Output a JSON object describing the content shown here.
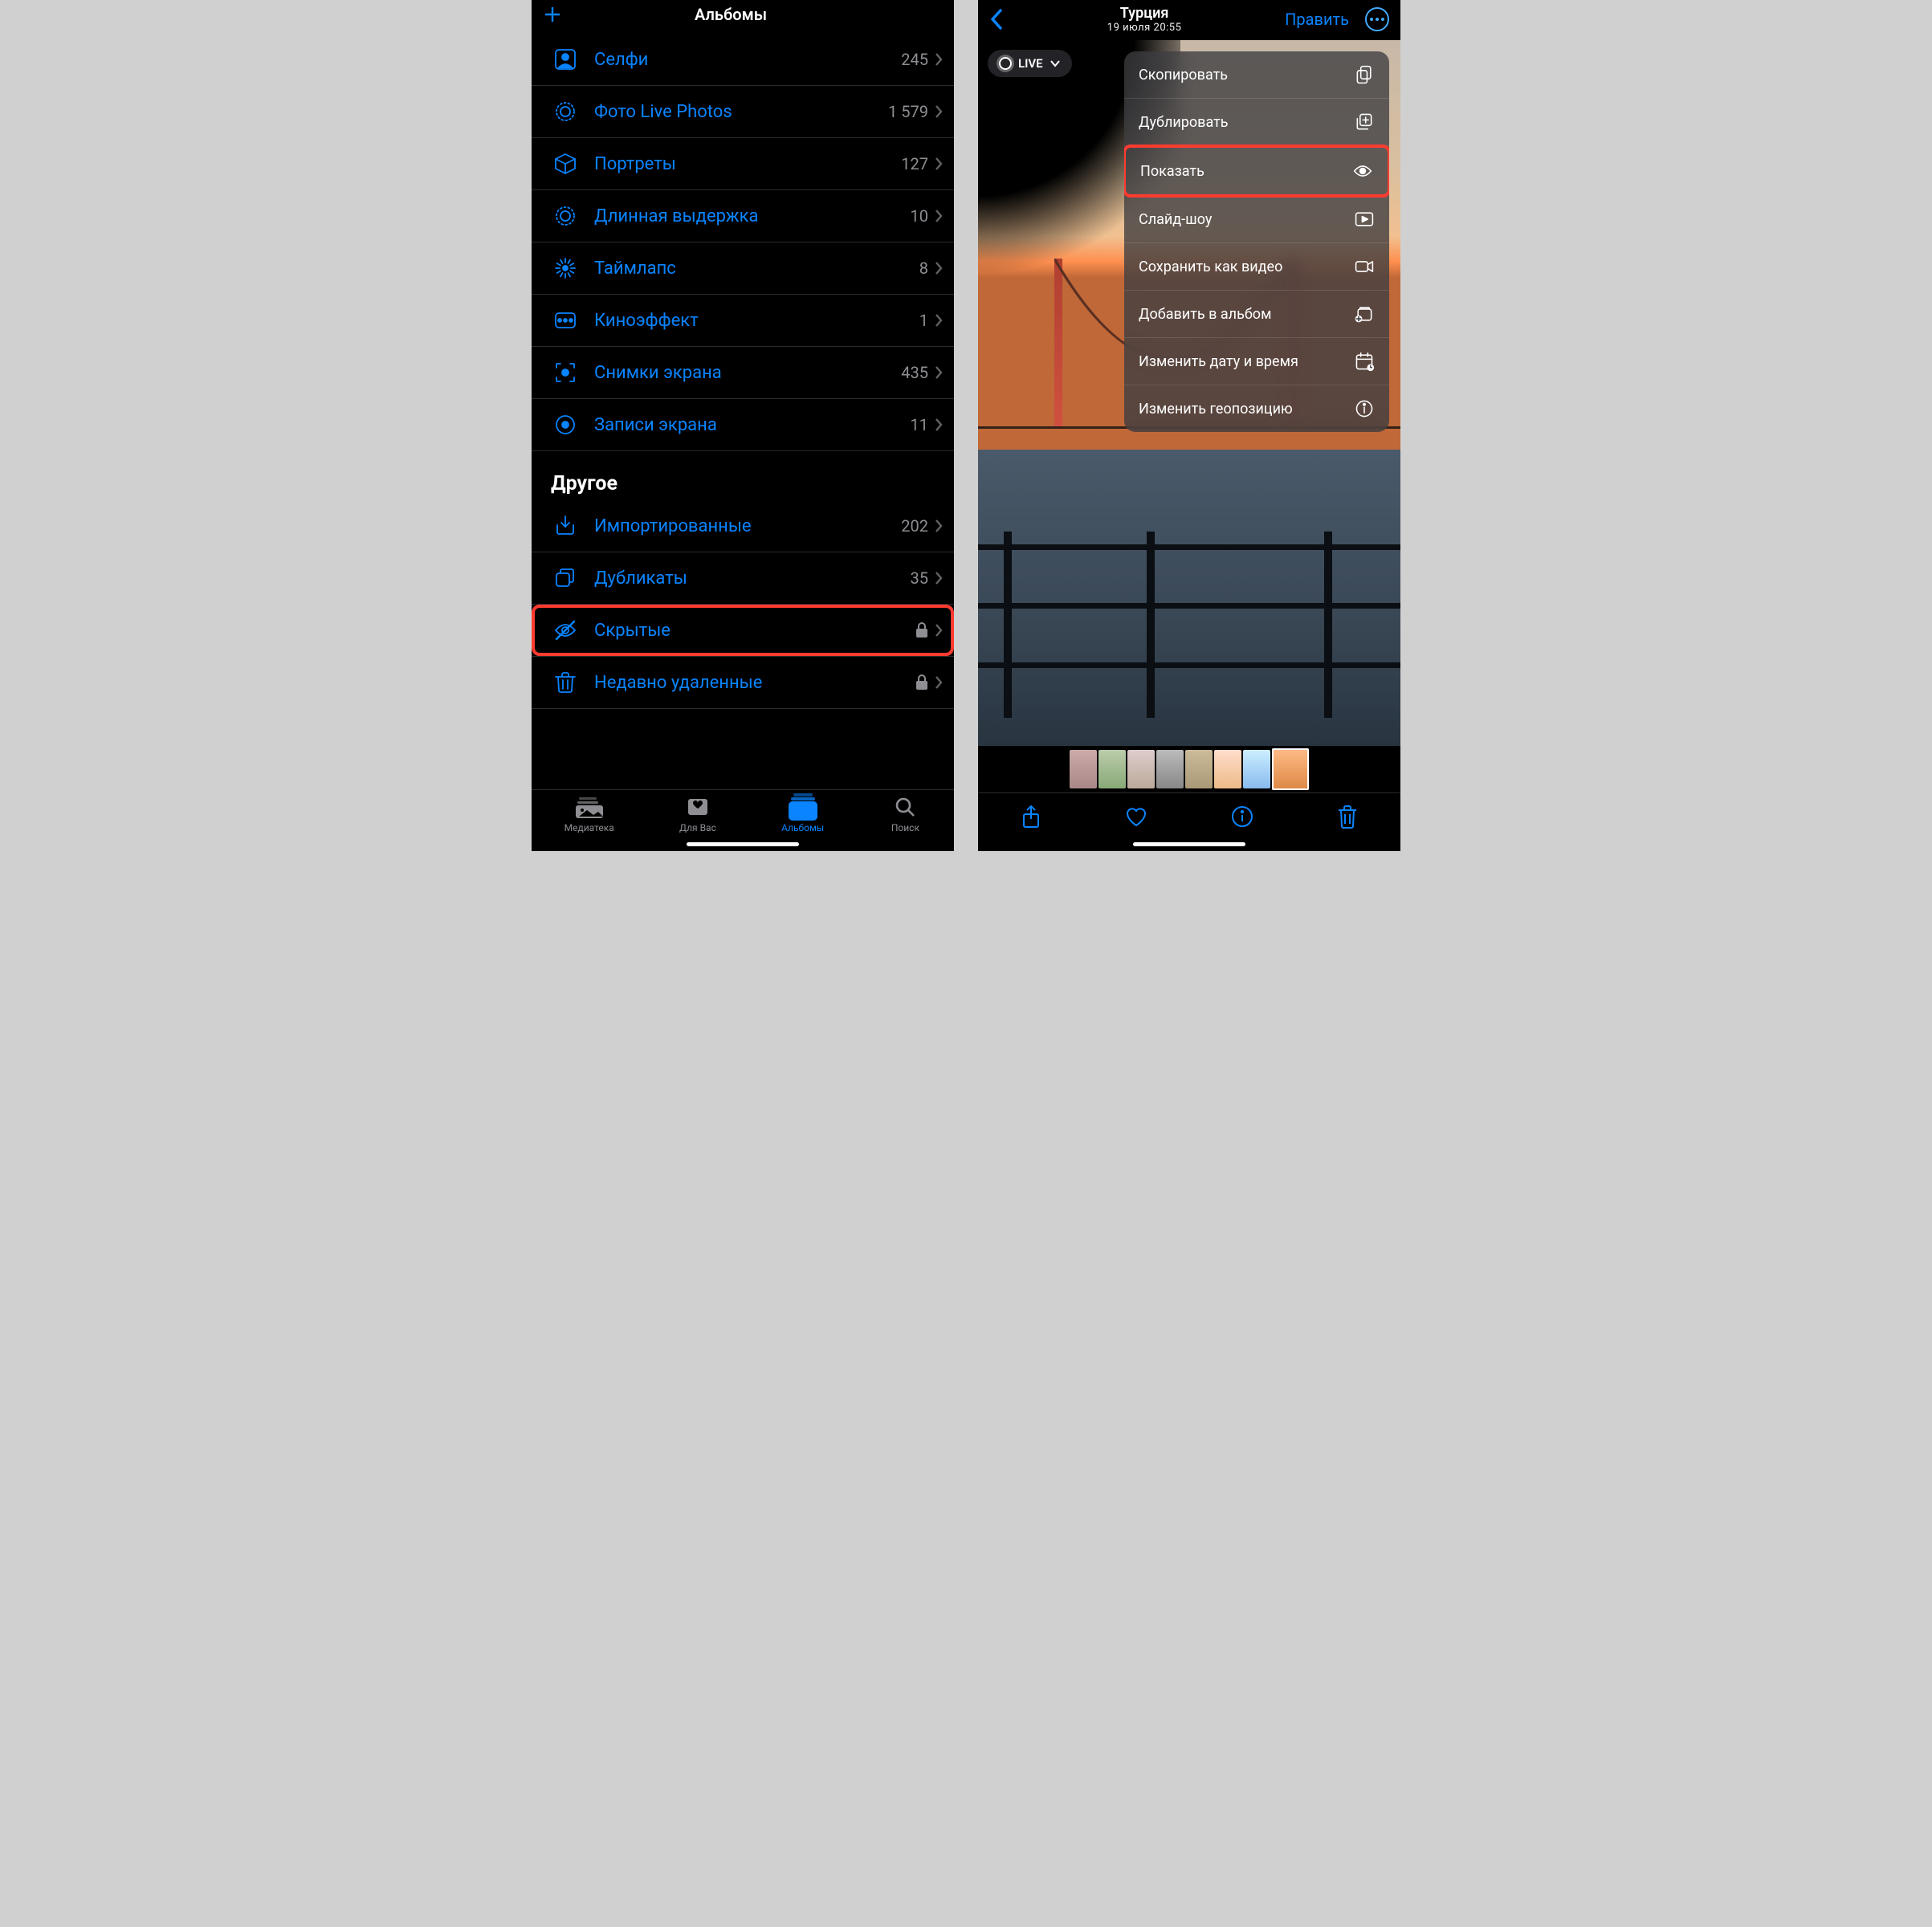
{
  "left": {
    "header_title": "Альбомы",
    "items": [
      {
        "icon": "person-square",
        "label": "Селфи",
        "count": "245"
      },
      {
        "icon": "live-photo",
        "label": "Фото Live Photos",
        "count": "1 579"
      },
      {
        "icon": "cube",
        "label": "Портреты",
        "count": "127"
      },
      {
        "icon": "live-photo",
        "label": "Длинная выдержка",
        "count": "10"
      },
      {
        "icon": "burst",
        "label": "Таймлапс",
        "count": "8"
      },
      {
        "icon": "cinema",
        "label": "Киноэффект",
        "count": "1"
      },
      {
        "icon": "viewfinder",
        "label": "Снимки экрана",
        "count": "435"
      },
      {
        "icon": "record",
        "label": "Записи экрана",
        "count": "11"
      }
    ],
    "section_other": "Другое",
    "other_items": [
      {
        "icon": "import",
        "label": "Импортированные",
        "count": "202",
        "locked": false
      },
      {
        "icon": "duplicate",
        "label": "Дубликаты",
        "count": "35",
        "locked": false
      },
      {
        "icon": "eye-slash",
        "label": "Скрытые",
        "count": "",
        "locked": true,
        "highlight": true
      },
      {
        "icon": "trash",
        "label": "Недавно удаленные",
        "count": "",
        "locked": true
      }
    ],
    "tabs": {
      "library": "Медиатека",
      "foryou": "Для Вас",
      "albums": "Альбомы",
      "search": "Поиск"
    }
  },
  "right": {
    "photo_title": "Турция",
    "photo_sub": "19 июля  20:55",
    "edit_label": "Править",
    "live_label": "LIVE",
    "menu": [
      {
        "label": "Скопировать",
        "icon": "copy"
      },
      {
        "label": "Дублировать",
        "icon": "plus-square"
      },
      {
        "label": "Показать",
        "icon": "eye",
        "highlight": true
      },
      {
        "label": "Слайд-шоу",
        "icon": "play-rect"
      },
      {
        "label": "Сохранить как видео",
        "icon": "video"
      },
      {
        "label": "Добавить в альбом",
        "icon": "album-add"
      },
      {
        "label": "Изменить дату и время",
        "icon": "calendar"
      },
      {
        "label": "Изменить геопозицию",
        "icon": "info"
      }
    ]
  }
}
